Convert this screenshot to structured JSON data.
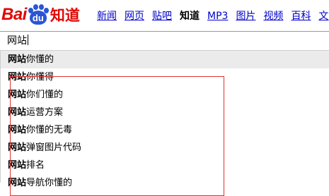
{
  "logo": {
    "text_bai": "Bai",
    "text_du": "du",
    "text_zhidao": "知道"
  },
  "nav": [
    {
      "label": "新闻",
      "active": false
    },
    {
      "label": "网页",
      "active": false
    },
    {
      "label": "贴吧",
      "active": false
    },
    {
      "label": "知道",
      "active": true
    },
    {
      "label": "MP3",
      "active": false
    },
    {
      "label": "图片",
      "active": false
    },
    {
      "label": "视频",
      "active": false
    },
    {
      "label": "百科",
      "active": false
    },
    {
      "label": "文",
      "active": false
    }
  ],
  "search": {
    "value": "网站"
  },
  "suggestions": [
    {
      "prefix": "网站",
      "rest": "你懂的"
    },
    {
      "prefix": "网站",
      "rest": "你懂得"
    },
    {
      "prefix": "网站",
      "rest": "你们懂的"
    },
    {
      "prefix": "网站",
      "rest": "运营方案"
    },
    {
      "prefix": "网站",
      "rest": "你懂的无毒"
    },
    {
      "prefix": "网站",
      "rest": "弹窗图片代码"
    },
    {
      "prefix": "网站",
      "rest": "排名"
    },
    {
      "prefix": "网站",
      "rest": "导航你懂的"
    }
  ],
  "colors": {
    "brand_red": "#e10601",
    "brand_blue": "#2a55d5",
    "link": "#0000cc",
    "highlight": "#ebebeb",
    "annotation_box": "#e03030"
  }
}
